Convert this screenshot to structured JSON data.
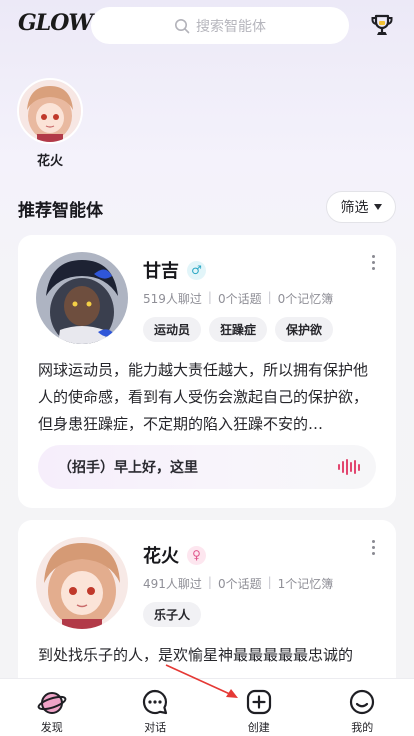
{
  "header": {
    "logo_text": "GLOW",
    "search_placeholder": "搜索智能体",
    "search_icon": "search-icon",
    "trophy_icon": "trophy-icon"
  },
  "recent": [
    {
      "name": "花火",
      "avatar": "anime-girl-twin-tails-avatar"
    }
  ],
  "section": {
    "title": "推荐智能体",
    "filter_label": "筛选"
  },
  "agents": [
    {
      "name": "甘吉",
      "gender": "male",
      "gender_symbol": "♂",
      "chats": "519人聊过",
      "topics": "0个话题",
      "memory": "0个记忆簿",
      "tags": [
        "运动员",
        "狂躁症",
        "保护欲"
      ],
      "description": "网球运动员，能力越大责任越大，所以拥有保护他人的使命感，看到有人受伤会激起自己的保护欲，但身患狂躁症，不定期的陷入狂躁不安的…",
      "greeting": "（招手）早上好，这里"
    },
    {
      "name": "花火",
      "gender": "female",
      "gender_symbol": "♀",
      "chats": "491人聊过",
      "topics": "0个话题",
      "memory": "1个记忆簿",
      "tags": [
        "乐子人"
      ],
      "description": "到处找乐子的人，是欢愉星神最最最最最忠诚的"
    }
  ],
  "nav": [
    {
      "label": "发现",
      "icon": "discover-planet-icon"
    },
    {
      "label": "对话",
      "icon": "chat-bubble-icon"
    },
    {
      "label": "创建",
      "icon": "create-plus-icon"
    },
    {
      "label": "我的",
      "icon": "profile-smile-icon"
    }
  ],
  "colors": {
    "accent_pink": "#e2466f",
    "male_badge": "#2aa7c4",
    "female_badge": "#e0578d",
    "annotation_arrow": "#e53935"
  }
}
